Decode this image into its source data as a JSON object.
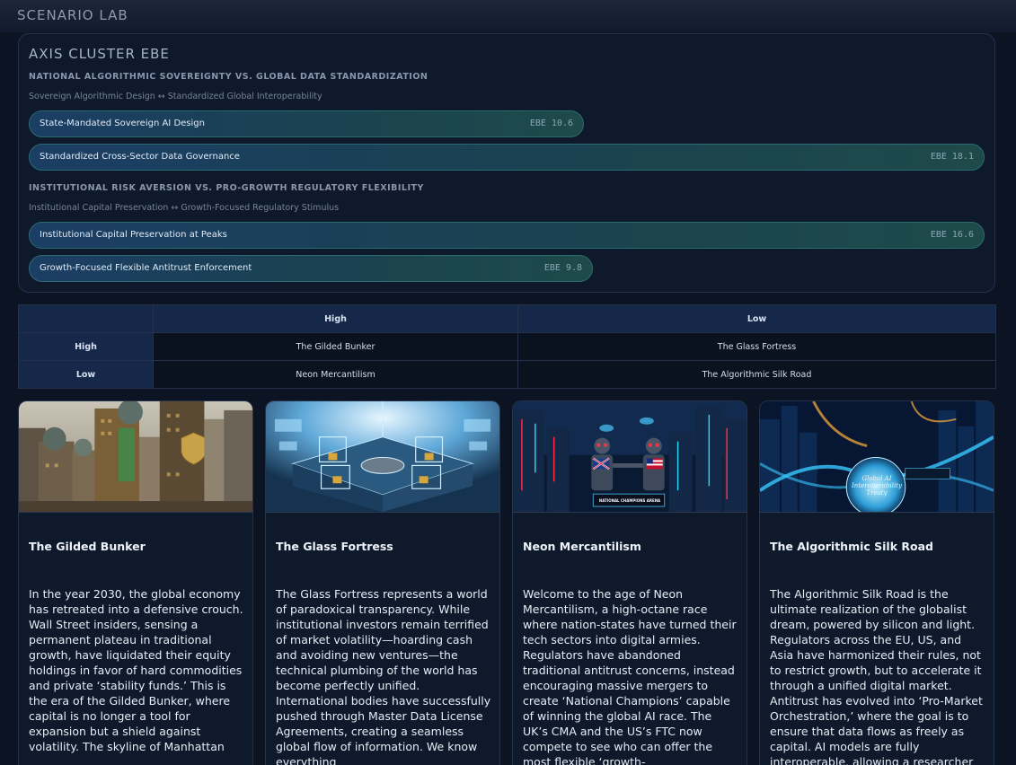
{
  "header": {
    "title": "SCENARIO LAB"
  },
  "axis_cluster": {
    "title": "AXIS CLUSTER EBE",
    "groups": [
      {
        "title": "NATIONAL ALGORITHMIC SOVEREIGNTY VS. GLOBAL DATA STANDARDIZATION",
        "subtitle": "Sovereign Algorithmic Design ↔ Standardized Global Interoperability",
        "bars": [
          {
            "label": "State-Mandated Sovereign AI Design",
            "value_text": "EBE 10.6",
            "value": 10.6
          },
          {
            "label": "Standardized Cross-Sector Data Governance",
            "value_text": "EBE 18.1",
            "value": 18.1
          }
        ]
      },
      {
        "title": "INSTITUTIONAL RISK AVERSION VS. PRO-GROWTH REGULATORY FLEXIBILITY",
        "subtitle": "Institutional Capital Preservation ↔ Growth-Focused Regulatory Stimulus",
        "bars": [
          {
            "label": "Institutional Capital Preservation at Peaks",
            "value_text": "EBE 16.6",
            "value": 16.6
          },
          {
            "label": "Growth-Focused Flexible Antitrust Enforcement",
            "value_text": "EBE 9.8",
            "value": 9.8
          }
        ]
      }
    ]
  },
  "matrix": {
    "columns": [
      "",
      "High",
      "Low"
    ],
    "rows": [
      {
        "label": "High",
        "cells": [
          "The Gilded Bunker",
          "The Glass Fortress"
        ]
      },
      {
        "label": "Low",
        "cells": [
          "Neon Mercantilism",
          "The Algorithmic Silk Road"
        ]
      }
    ]
  },
  "cards": [
    {
      "title": "The Gilded Bunker",
      "body": "In the year 2030, the global economy has retreated into a defensive crouch. Wall Street insiders, sensing a permanent plateau in traditional growth, have liquidated their equity holdings in favor of hard commodities and private ‘stability funds.’ This is the era of the Gilded Bunker, where capital is no longer a tool for expansion but a shield against volatility. The skyline of Manhattan"
    },
    {
      "title": "The Glass Fortress",
      "body": "The Glass Fortress represents a world of paradoxical transparency. While institutional investors remain terrified of market volatility—hoarding cash and avoiding new ventures—the technical plumbing of the world has become perfectly unified. International bodies have successfully pushed through Master Data License Agreements, creating a seamless global flow of information. We know everything"
    },
    {
      "title": "Neon Mercantilism",
      "body": "Welcome to the age of Neon Mercantilism, a high-octane race where nation-states have turned their tech sectors into digital armies. Regulators have abandoned traditional antitrust concerns, instead encouraging massive mergers to create ‘National Champions’ capable of winning the global AI race. The UK’s CMA and the US’s FTC now compete to see who can offer the most flexible ‘growth-",
      "image_caption": "NATIONAL CHAMPIONS ARENA"
    },
    {
      "title": "The Algorithmic Silk Road",
      "body": "The Algorithmic Silk Road is the ultimate realization of the globalist dream, powered by silicon and light. Regulators across the EU, US, and Asia have harmonized their rules, not to restrict growth, but to accelerate it through a unified digital market. Antitrust has evolved into ‘Pro-Market Orchestration,’ where the goal is to ensure that data flows as freely as capital. AI models are fully interoperable, allowing a researcher",
      "image_caption": "Global AI Interoperability Treaty"
    }
  ]
}
